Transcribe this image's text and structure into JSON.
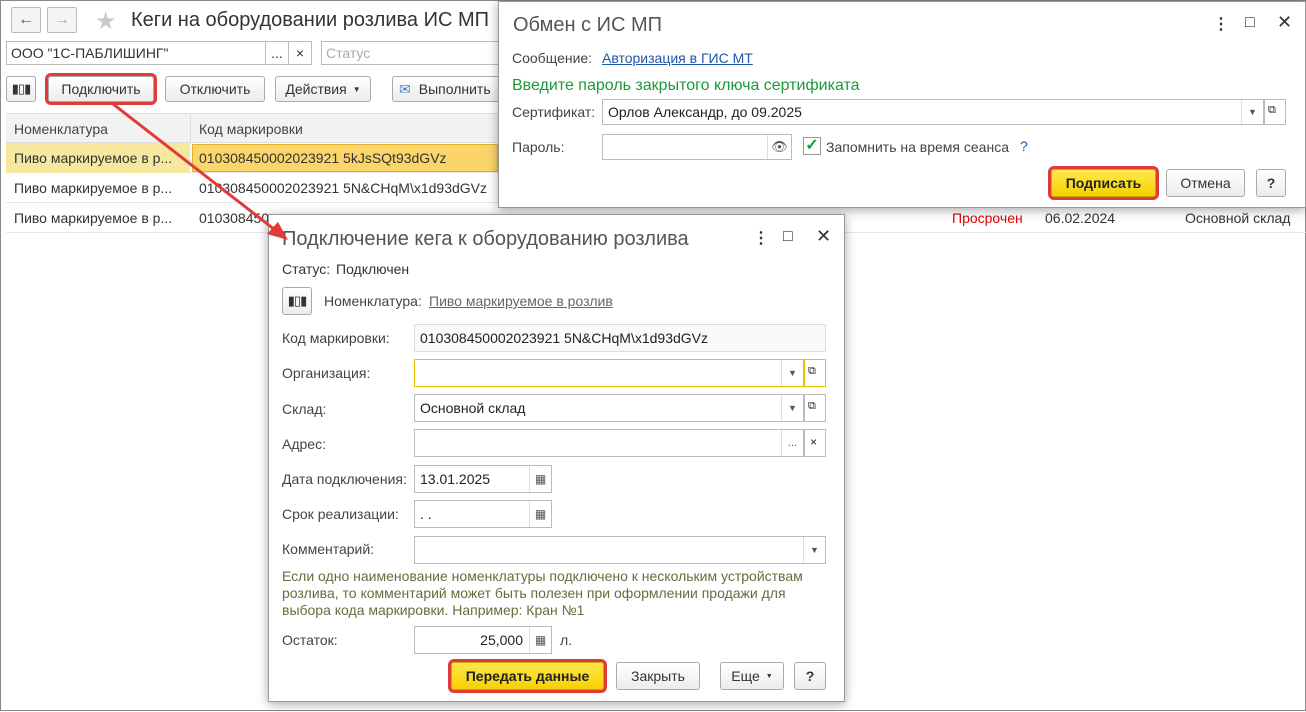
{
  "main": {
    "title": "Кеги на оборудовании розлива ИС МП",
    "org_value": "ООО \"1С-ПАБЛИШИНГ\"",
    "status_placeholder": "Статус",
    "ellipsis": "...",
    "clear": "×",
    "toolbar": {
      "connect": "Подключить",
      "disconnect": "Отключить",
      "actions": "Действия",
      "execute": "Выполнить"
    },
    "columns": [
      "Номенклатура",
      "Код маркировки"
    ],
    "rows": [
      {
        "nomenclature": "Пиво маркируемое в р...",
        "code": "010308450002023921 5kJsSQt93dGVz"
      },
      {
        "nomenclature": "Пиво маркируемое в р...",
        "code": "010308450002023921 5N&CHqM\\x1d93dGVz"
      },
      {
        "nomenclature": "Пиво маркируемое в р...",
        "code": "010308450",
        "status": "Просрочен",
        "date": "06.02.2024",
        "warehouse": "Основной склад"
      }
    ]
  },
  "exchange": {
    "title": "Обмен с ИС МП",
    "message_label": "Сообщение:",
    "message_link": "Авторизация в ГИС МТ",
    "prompt": "Введите пароль закрытого ключа сертификата",
    "cert_label": "Сертификат:",
    "cert_value": "Орлов Александр, до 09.2025",
    "password_label": "Пароль:",
    "remember_label": "Запомнить на время сеанса",
    "help": "?",
    "sign": "Подписать",
    "cancel": "Отмена"
  },
  "connect": {
    "title": "Подключение кега к оборудованию розлива",
    "status_label": "Статус:",
    "status_value": "Подключен",
    "nomenclature_label": "Номенклатура:",
    "nomenclature_value": "Пиво маркируемое в розлив",
    "code_label": "Код маркировки:",
    "code_value": "010308450002023921 5N&CHqM\\x1d93dGVz",
    "org_label": "Организация:",
    "org_value": "",
    "warehouse_label": "Склад:",
    "warehouse_value": "Основной склад",
    "address_label": "Адрес:",
    "address_value": "",
    "date_label": "Дата подключения:",
    "date_value": "13.01.2025",
    "term_label": "Срок реализации:",
    "term_value": " .  .",
    "comment_label": "Комментарий:",
    "comment_value": "",
    "hint": "Если одно наименование номенклатуры подключено к нескольким устройствам розлива, то комментарий может быть полезен при оформлении продажи для выбора кода маркировки. Например: Кран №1",
    "rest_label": "Остаток:",
    "rest_value": "25,000",
    "rest_unit": "л.",
    "send": "Передать данные",
    "close": "Закрыть",
    "more": "Еще",
    "help": "?"
  },
  "colors": {
    "highlight": "#e03a3a",
    "yellow_btn": "#f5d100",
    "green_text": "#1a9a3a",
    "link": "#2056a8",
    "overdue": "#e00000"
  }
}
